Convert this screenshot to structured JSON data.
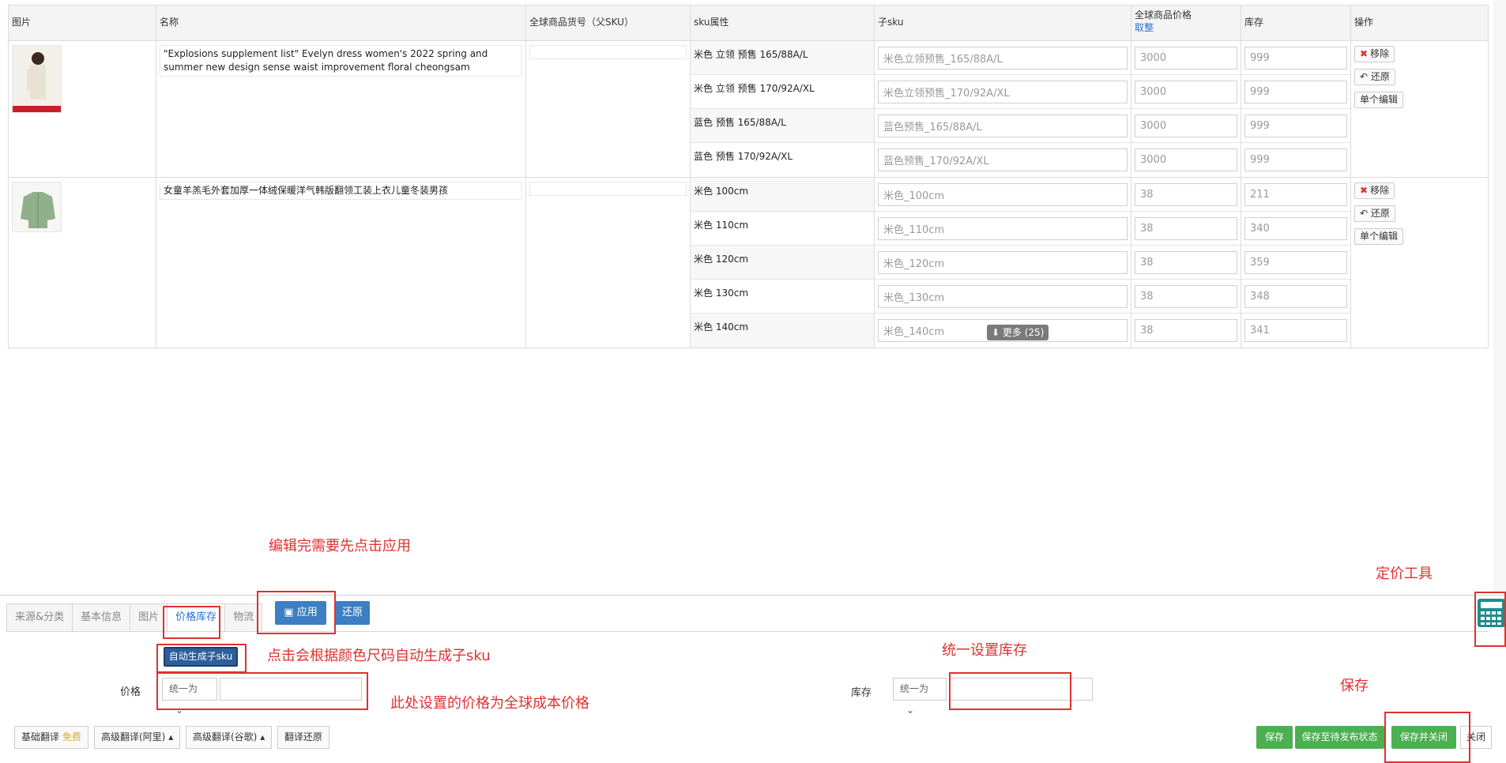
{
  "table": {
    "headers": {
      "image": "图片",
      "name": "名称",
      "parent_sku": "全球商品货号（父SKU）",
      "sku_attr": "sku属性",
      "child_sku": "子sku",
      "price": "全球商品价格",
      "price_link": "取整",
      "stock": "库存",
      "ops": "操作"
    },
    "products": [
      {
        "name": "\"Explosions supplement list\" Evelyn dress women's 2022 spring and summer new design sense waist improvement floral cheongsam",
        "rows": [
          {
            "attr": "米色 立领 预售 165/88A/L",
            "sku": "米色立领预售_165/88A/L",
            "price": "3000",
            "stock": "999"
          },
          {
            "attr": "米色 立领 预售 170/92A/XL",
            "sku": "米色立领预售_170/92A/XL",
            "price": "3000",
            "stock": "999"
          },
          {
            "attr": "蓝色 预售 165/88A/L",
            "sku": "蓝色预售_165/88A/L",
            "price": "3000",
            "stock": "999"
          },
          {
            "attr": "蓝色 预售 170/92A/XL",
            "sku": "蓝色预售_170/92A/XL",
            "price": "3000",
            "stock": "999"
          }
        ]
      },
      {
        "name": "女童羊羔毛外套加厚一体绒保暖洋气韩版翻领工装上衣儿童冬装男孩",
        "rows": [
          {
            "attr": "米色 100cm",
            "sku": "米色_100cm",
            "price": "38",
            "stock": "211"
          },
          {
            "attr": "米色 110cm",
            "sku": "米色_110cm",
            "price": "38",
            "stock": "340"
          },
          {
            "attr": "米色 120cm",
            "sku": "米色_120cm",
            "price": "38",
            "stock": "359"
          },
          {
            "attr": "米色 130cm",
            "sku": "米色_130cm",
            "price": "38",
            "stock": "348"
          },
          {
            "attr": "米色 140cm",
            "sku": "米色_140cm",
            "price": "38",
            "stock": "341"
          }
        ],
        "more_label": "更多 (25)"
      }
    ],
    "ops": {
      "remove": "移除",
      "restore": "还原",
      "single_edit": "单个编辑"
    }
  },
  "annotations": {
    "apply_note": "编辑完需要先点击应用",
    "pricing_tool": "定价工具",
    "autogen_note": "点击会根据颜色尺码自动生成子sku",
    "stock_note": "统一设置库存",
    "save_note": "保存",
    "price_note": "此处设置的价格为全球成本价格"
  },
  "bottom": {
    "tabs": [
      "来源&分类",
      "基本信息",
      "图片",
      "价格库存",
      "物流"
    ],
    "active_tab": "价格库存",
    "apply": "应用",
    "restore": "还原",
    "autogen": "自动生成子sku",
    "price_label": "价格",
    "stock_label": "库存",
    "unify": "统一为",
    "footer_left": {
      "basic_translate": "基础翻译",
      "free": "免费",
      "adv_ali": "高级翻译(阿里)",
      "adv_google": "高级翻译(谷歌)",
      "translate_restore": "翻译还原"
    },
    "footer_right": {
      "save": "保存",
      "save_pending": "保存至待发布状态",
      "save_close": "保存并关闭",
      "close": "关闭"
    }
  },
  "colors": {
    "accent_blue": "#3d7ec4",
    "green": "#4caf50",
    "annotation_red": "#e03131"
  }
}
